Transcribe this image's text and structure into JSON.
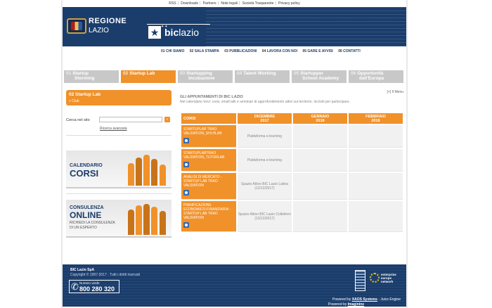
{
  "toplinks": [
    "RSS",
    "Downloads",
    "Partners",
    "Note legali",
    "Società Trasparente",
    "Privacy policy"
  ],
  "banner": {
    "regione": "REGIONE",
    "lazio": "LAZIO",
    "bic_a": "bic",
    "bic_b": "lazio"
  },
  "mainnav": [
    {
      "num": "01",
      "label": "CHI SIAMO"
    },
    {
      "num": "02",
      "label": "SALA STAMPA"
    },
    {
      "num": "03",
      "label": "PUBBLICAZIONI"
    },
    {
      "num": "04",
      "label": "LAVORA CON NOI"
    },
    {
      "num": "05",
      "label": "GARE E AVVISI"
    },
    {
      "num": "06",
      "label": "CONTATTI"
    }
  ],
  "phases": [
    {
      "num": "01",
      "label": "Startup",
      "label2": "Storming"
    },
    {
      "num": "02",
      "label": "Startup Lab",
      "label2": ""
    },
    {
      "num": "03",
      "label": "Startupping",
      "label2": "Incubazione"
    },
    {
      "num": "04",
      "label": "Talent Working",
      "label2": ""
    },
    {
      "num": "05",
      "label": "Startupper",
      "label2": "School Academy"
    },
    {
      "num": "06",
      "label": "Opportunità",
      "label2": "dall'Europa"
    }
  ],
  "sidebar": {
    "title_num": "02",
    "title": "Startup Lab",
    "sub": "+ Club",
    "search_label": "Cerca nel sito",
    "search_value": "",
    "advanced": "Ricerca avanzata",
    "promo1_big": "CALENDARIO",
    "promo1_big2": "CORSI",
    "promo2_a": "CONSULENZA",
    "promo2_b": "ONLINE",
    "promo2_c": "RICHIEDI LA CONSULENZA",
    "promo2_d": "DI UN ESPERTO"
  },
  "content": {
    "toggle": "[+] Il Menu",
    "title": "GLI APPUNTAMENTI DI BIC LAZIO",
    "subtitle": "Nel calendario trovi: corsi, small talk e seminari di approfondimento attivi sul territorio. Iscriviti per partecipare.",
    "headers": {
      "corsi": "CORSI",
      "m1a": "DICEMBRE",
      "m1b": "2017",
      "m2a": "GENNAIO",
      "m2b": "2018",
      "m3a": "FEBBRAIO",
      "m3b": "2018"
    },
    "rows": [
      {
        "course": "STARTUPLAB TRAO VALIDATION_SHLHLAB",
        "dec": "Piattaforma e-learning",
        "dec2": ""
      },
      {
        "course": "STARTUPLABTRAO VALIDATION_TUTORLAB",
        "dec": "Piattaforma e-learning",
        "dec2": ""
      },
      {
        "course": "ANALISI DI MERCATO - STARTUP LAB TRAO VALIDATION",
        "dec": "Spazio Attivo BIC Lazio Latina",
        "dec2": "(12/12/2017)"
      },
      {
        "course": "PIANIFICAZIONE ECONOMICO-FINANZIARIA - STARTUP LAB TRAO VALIDATION",
        "dec": "Spazio Attivo BIC Lazio Colleferro",
        "dec2": "(13/12/2017)"
      }
    ]
  },
  "footer": {
    "company": "BIC Lazio SpA",
    "copy": "Copyright © 1997-2017 · Tutti i diritti riservati",
    "numverde_label": "Numero verde",
    "numverde": "800 280 320",
    "een1": "enterprise",
    "een2": "europe",
    "een3": "network",
    "powered1_a": "Powered by",
    "powered1_b": "XAOS Systems",
    "powered1_c": "· Juice Engine",
    "powered2_a": "Powered by",
    "powered2_b": "Imaginine"
  }
}
